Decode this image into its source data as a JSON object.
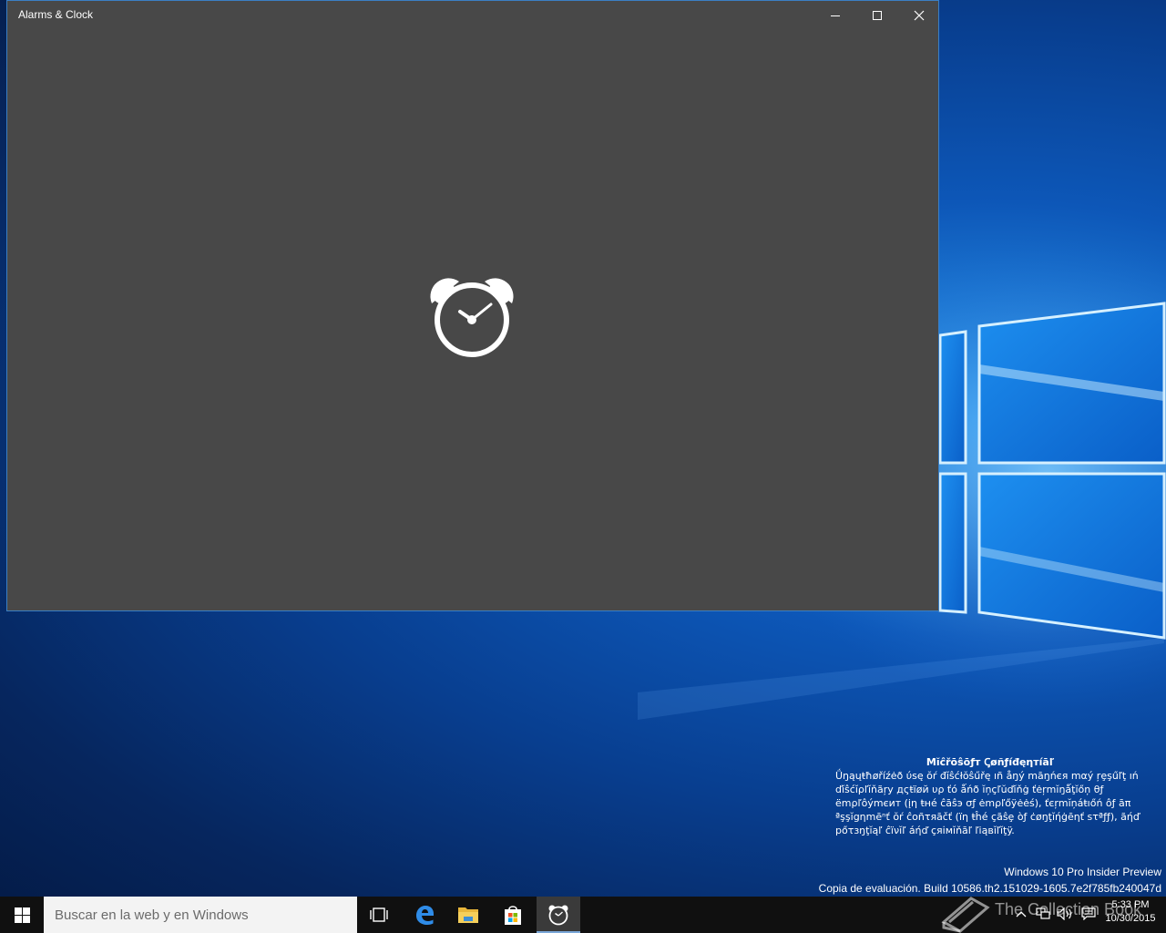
{
  "window": {
    "title": "Alarms & Clock",
    "minimize_icon": "minimize-icon",
    "maximize_icon": "maximize-icon",
    "close_icon": "close-icon",
    "splash_icon": "alarm-clock-icon"
  },
  "confidential": {
    "title": "Mĭĉřōŝōƒт Ꞔøñƒíđęηтíāľ",
    "body": "Ǘŋąųŧħøříźėð ύѕę ŏŕ đĭŝćłŏŝűřę ıñ åŋý māŋńєя mαý ŗȩşűľţ ıń ďĭŝćĭρľĭňãŗy дςŧïøй υρ ťό ǻńð ĭņçľŭďĭňġ ťėŗmĭŋǻţĭőņ θƒ ёmρľôýmєит (įη ŧнé ĉāŝэ σƒ ėmρľőÿėėś), ťєŗmĭņáŧıőń ôƒ āπ ªşşĭgηmēⁿť ŏŕ ĉoñτяāčť (ïη ŧĥé çãŝȩ òƒ ċøŋţĭήġēηť ѕτªƒƒ), ãήď рőτзŋţĭąľ ĉïνĭľ áήď çяімĭňāľ ľiąвĭľĭţÿ."
  },
  "watermark": {
    "line1": "Windows 10 Pro Insider Preview",
    "line2": "Copia de evaluación. Build 10586.th2.151029-1605.7e2f785fb240047d"
  },
  "taskbar": {
    "start_icon": "windows-start-icon",
    "search_placeholder": "Buscar en la web y en Windows",
    "apps": [
      {
        "name": "task-view-icon"
      },
      {
        "name": "edge-icon"
      },
      {
        "name": "file-explorer-icon"
      },
      {
        "name": "store-icon"
      },
      {
        "name": "alarms-clock-icon",
        "active": true
      }
    ],
    "overlay_text": "The Collection Book",
    "tray": {
      "time": "5:33 PM",
      "date": "10/30/2015"
    }
  },
  "colors": {
    "window_bg": "#484848",
    "taskbar_bg": "#101010",
    "window_border": "#3b7fc4",
    "active_indicator": "#7aa7d8"
  }
}
